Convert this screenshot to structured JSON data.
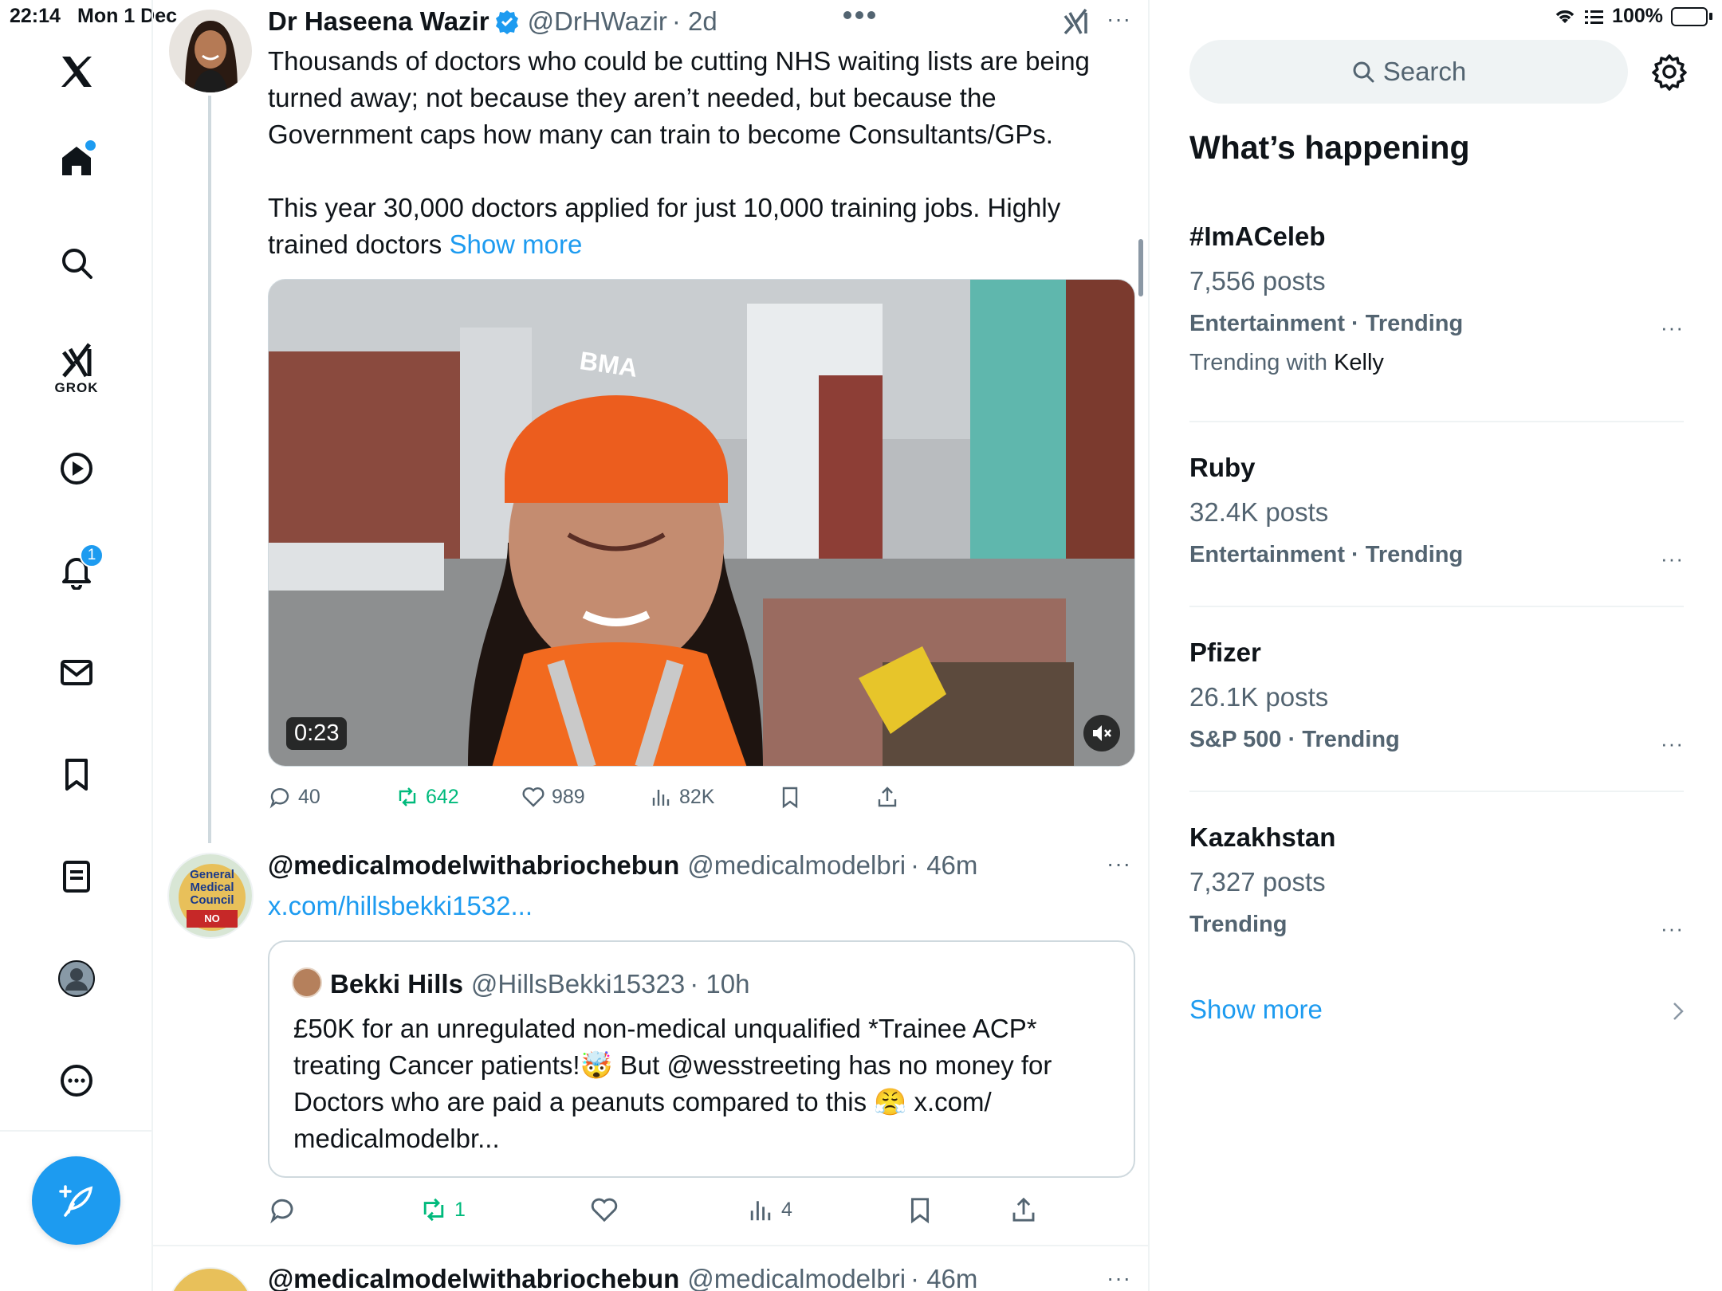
{
  "status_bar": {
    "time": "22:14",
    "date": "Mon 1 Dec",
    "battery": "100%"
  },
  "nav": {
    "grok_label": "GROK",
    "notifications_badge": "1"
  },
  "tweet1": {
    "name": "Dr Haseena Wazir",
    "handle": "@DrHWazir",
    "time": "· 2d",
    "text_p1": "Thousands of doctors who could be cutting NHS waiting lists are being turned away; not because they aren’t needed, but because the Government caps how many can train to become Consultants/GPs.",
    "text_p2": "This year 30,000 doctors applied for just 10,000 training jobs. Highly trained doctors",
    "show_more": "Show more",
    "video_duration": "0:23",
    "video_hat_text": "BMA",
    "replies": "40",
    "retweets": "642",
    "likes": "989",
    "views": "82K"
  },
  "tweet2": {
    "name": "@medicalmodelwithabriochebun",
    "handle": "@medicalmodelbri",
    "time": "· 46m",
    "link": "x.com/hillsbekki1532...",
    "avatar_text": "General Medical Council",
    "avatar_sign": "NO",
    "quote": {
      "name": "Bekki Hills",
      "handle": "@HillsBekki15323",
      "time": "· 10h",
      "line1": "£50K for an unregulated non-medical unqualified *Trainee ACP*",
      "line2": "treating Cancer patients!🤯 But @wesstreeting has no money for",
      "line3": "Doctors who are paid a peanuts compared to this 😤 x.com/",
      "line4": "medicalmodelbr..."
    },
    "retweets": "1",
    "views": "4"
  },
  "tweet3": {
    "name": "@medicalmodelwithabriochebun",
    "handle": "@medicalmodelbri",
    "time": "· 46m"
  },
  "sidebar": {
    "search_placeholder": "Search",
    "title": "What’s happening",
    "trends": [
      {
        "name": "#ImACeleb",
        "posts": "7,556 posts",
        "category": "Entertainment · Trending",
        "with_prefix": "Trending with",
        "with_name": "Kelly"
      },
      {
        "name": "Ruby",
        "posts": "32.4K posts",
        "category": "Entertainment · Trending"
      },
      {
        "name": "Pfizer",
        "posts": "26.1K posts",
        "category": "S&P 500 · Trending"
      },
      {
        "name": "Kazakhstan",
        "posts": "7,327 posts",
        "category": "Trending"
      }
    ],
    "show_more": "Show more"
  },
  "colors": {
    "accent": "#1d9bf0",
    "retweet": "#00ba7c",
    "muted": "#536471"
  }
}
